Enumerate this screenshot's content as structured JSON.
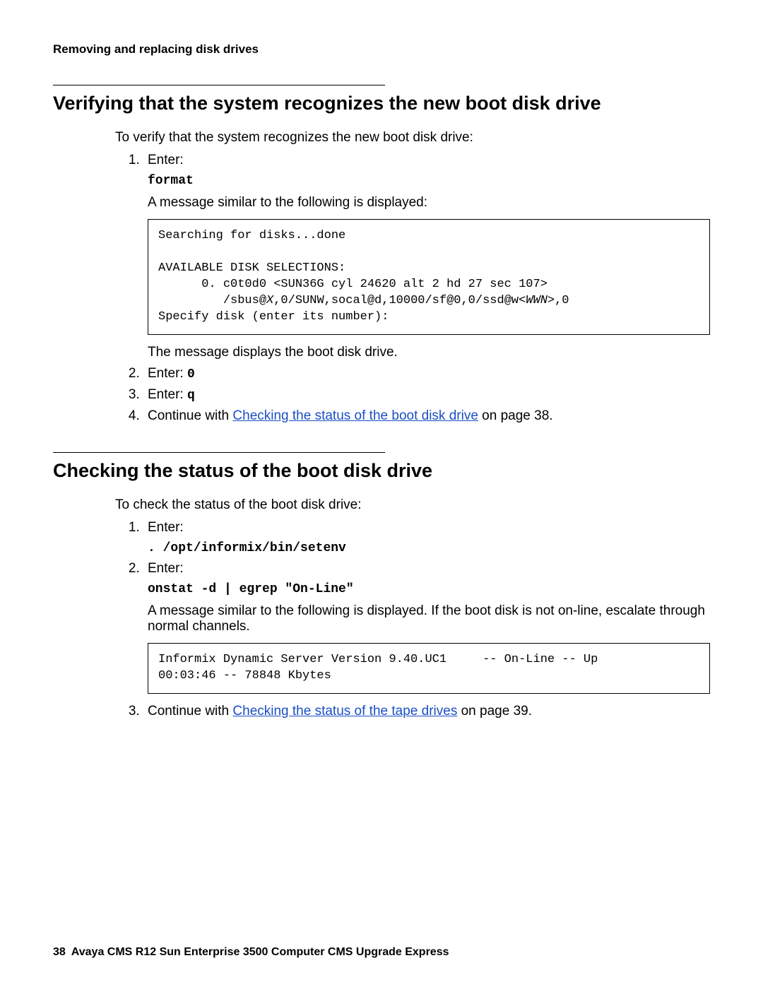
{
  "runningHeader": "Removing and replacing disk drives",
  "section1": {
    "heading": "Verifying that the system recognizes the new boot disk drive",
    "intro": "To verify that the system recognizes the new boot disk drive:",
    "step1_label": "Enter:",
    "step1_cmd": "format",
    "step1_after": "A message similar to the following is displayed:",
    "code_line1": "Searching for disks...done",
    "code_line2": "",
    "code_line3": "AVAILABLE DISK SELECTIONS:",
    "code_line4": "      0. c0t0d0 <SUN36G cyl 24620 alt 2 hd 27 sec 107>",
    "code_line5_a": "         /sbus@",
    "code_line5_b": "X",
    "code_line5_c": ",0/SUNW,socal@d,10000/sf@0,0/ssd@w",
    "code_line5_d": "<WWN>",
    "code_line5_e": ",0",
    "code_line6": "Specify disk (enter its number):",
    "step1_after2": "The message displays the boot disk drive.",
    "step2_label": "Enter: ",
    "step2_cmd": "0",
    "step3_label": "Enter: ",
    "step3_cmd": "q",
    "step4_a": "Continue with ",
    "step4_link": "Checking the status of the boot disk drive",
    "step4_b": " on page 38."
  },
  "section2": {
    "heading": "Checking the status of the boot disk drive",
    "intro": "To check the status of the boot disk drive:",
    "step1_label": "Enter:",
    "step1_cmd": ". /opt/informix/bin/setenv",
    "step2_label": "Enter:",
    "step2_cmd": "onstat -d | egrep \"On-Line\"",
    "step2_after": "A message similar to the following is displayed. If the boot disk is not on-line, escalate through normal channels.",
    "code_line1": "Informix Dynamic Server Version 9.40.UC1     -- On-Line -- Up ",
    "code_line2": "00:03:46 -- 78848 Kbytes",
    "step3_a": "Continue with ",
    "step3_link": "Checking the status of the tape drives",
    "step3_b": " on page 39."
  },
  "footer": {
    "page": "38",
    "title": "Avaya CMS R12 Sun Enterprise 3500 Computer CMS Upgrade Express"
  }
}
